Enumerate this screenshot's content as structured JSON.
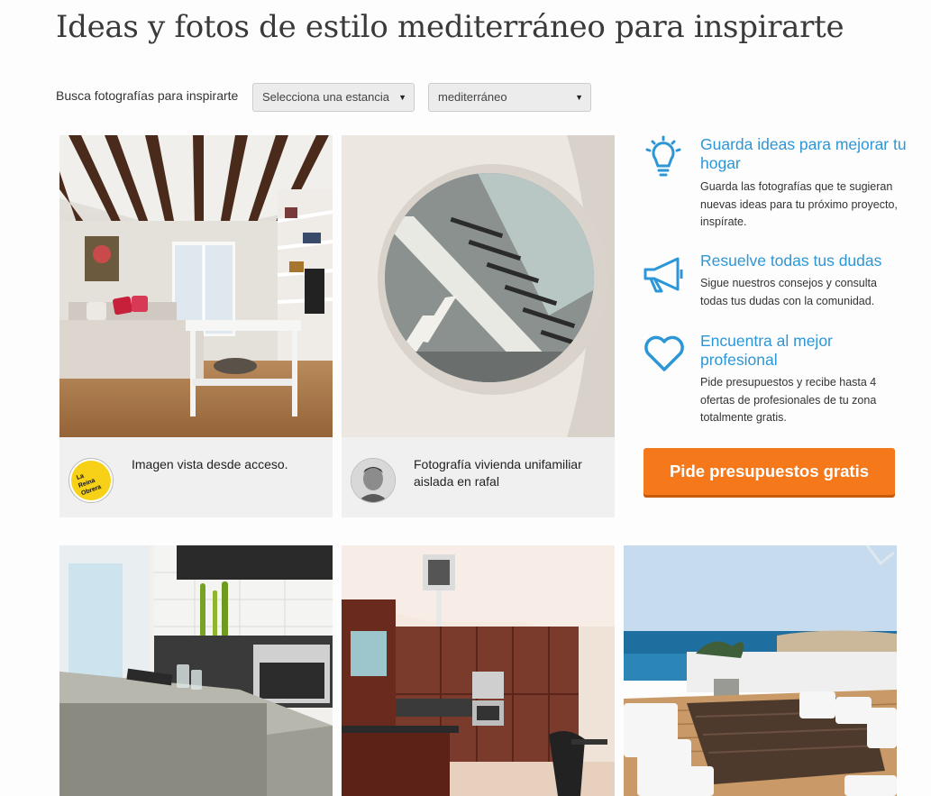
{
  "page": {
    "title": "Ideas y fotos de estilo mediterráneo para inspirarte"
  },
  "filters": {
    "label": "Busca fotografías para inspirarte",
    "room_select": "Selecciona una estancia",
    "style_select": "mediterráneo"
  },
  "cards": [
    {
      "caption": "Imagen vista desde acceso.",
      "avatar_text": "La Reina Obrera"
    },
    {
      "caption": "Fotografía vivienda unifamiliar aislada en rafal"
    }
  ],
  "benefits": [
    {
      "title": "Guarda ideas para mejorar tu hogar",
      "text": "Guarda las fotografías que te sugieran nuevas ideas para tu próximo proyecto, inspírate.",
      "icon": "lightbulb-icon"
    },
    {
      "title": "Resuelve todas tus dudas",
      "text": "Sigue nuestros consejos y consulta todas tus dudas con la comunidad.",
      "icon": "megaphone-icon"
    },
    {
      "title": "Encuentra al mejor profesional",
      "text": "Pide presupuestos y recibe hasta 4 ofertas de profesionales de tu zona totalmente gratis.",
      "icon": "heart-icon"
    }
  ],
  "cta": {
    "label": "Pide presupuestos gratis"
  },
  "colors": {
    "accent_blue": "#2d96d6",
    "cta_orange": "#f5781b"
  }
}
